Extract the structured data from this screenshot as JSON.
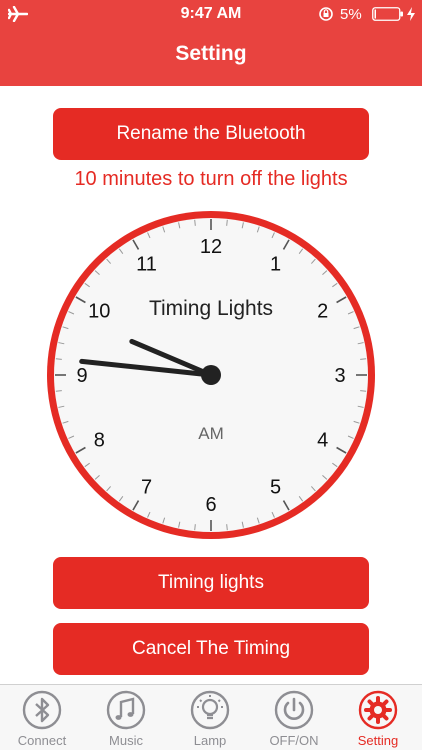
{
  "status_bar": {
    "time": "9:47 AM",
    "battery_percent": "5%",
    "battery_level": 0.05
  },
  "header": {
    "title": "Setting"
  },
  "buttons": {
    "rename": "Rename the Bluetooth",
    "timing": "Timing lights",
    "cancel": "Cancel The Timing"
  },
  "status_message": "10 minutes to turn off the lights",
  "clock": {
    "label": "Timing Lights",
    "period": "AM",
    "numbers": [
      "12",
      "1",
      "2",
      "3",
      "4",
      "5",
      "6",
      "7",
      "8",
      "9",
      "10",
      "11"
    ],
    "hour": 9,
    "minute": 46,
    "colors": {
      "rim": "#e52b24",
      "face": "#f7f7f7",
      "hand": "#222222"
    }
  },
  "tabs": [
    {
      "label": "Connect",
      "icon": "bluetooth-icon",
      "active": false
    },
    {
      "label": "Music",
      "icon": "music-note-icon",
      "active": false
    },
    {
      "label": "Lamp",
      "icon": "lamp-icon",
      "active": false
    },
    {
      "label": "OFF/ON",
      "icon": "power-icon",
      "active": false
    },
    {
      "label": "Setting",
      "icon": "gear-icon",
      "active": true
    }
  ],
  "colors": {
    "header": "#e8433f",
    "accent": "#e52b24",
    "tab_inactive": "#8e8e93"
  }
}
